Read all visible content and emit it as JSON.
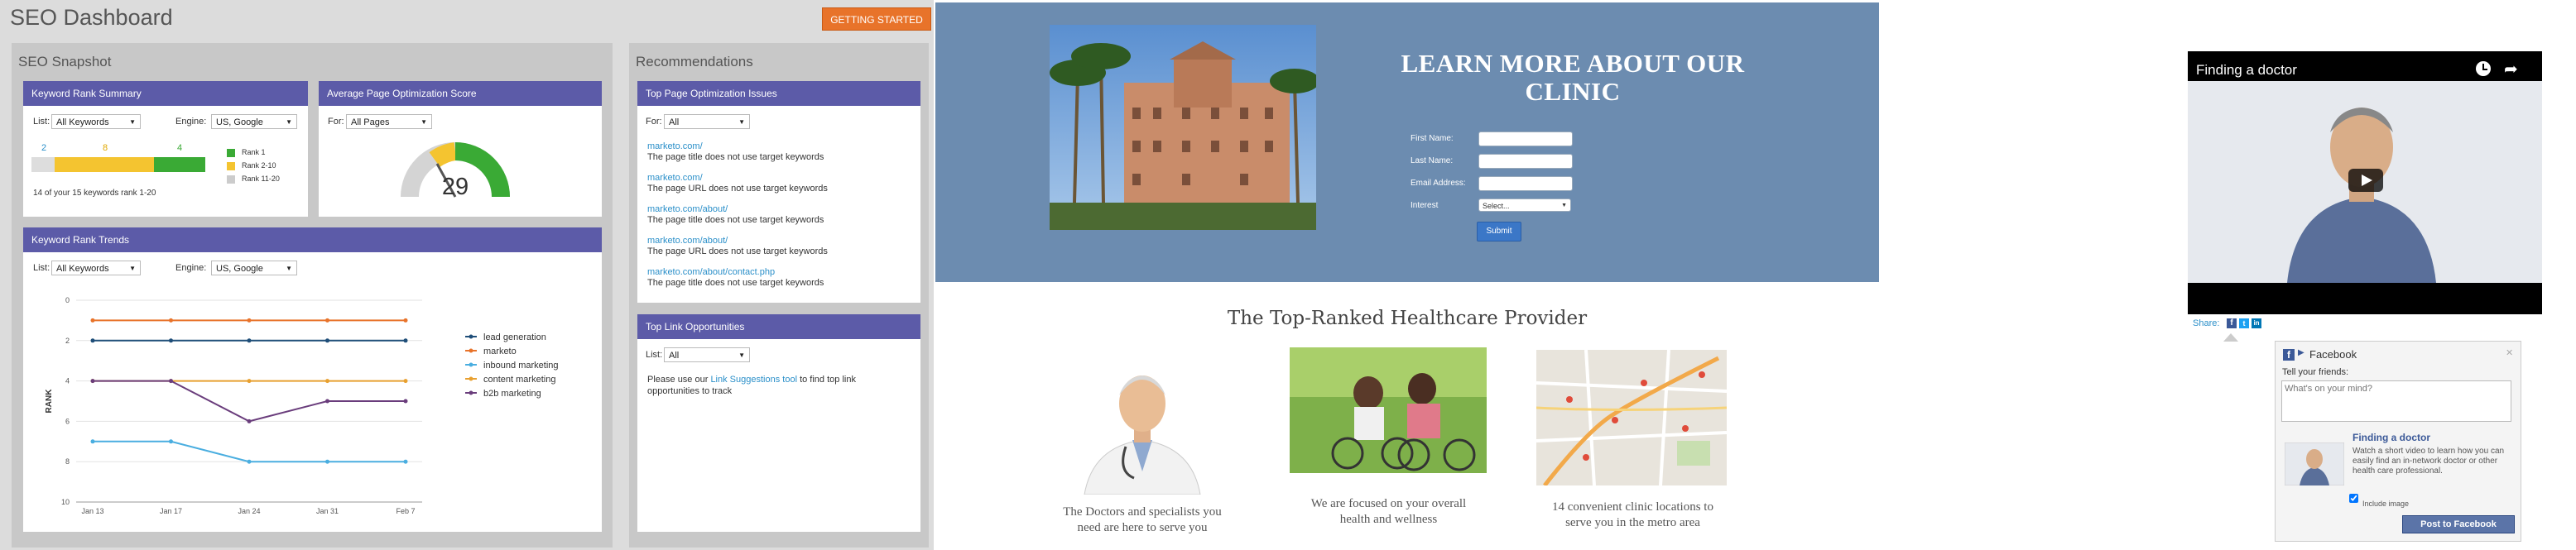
{
  "dashboard": {
    "title": "SEO Dashboard",
    "getting_started": "GETTING STARTED",
    "snapshot_title": "SEO Snapshot",
    "recommendations_title": "Recommendations",
    "krs": {
      "title": "Keyword Rank Summary",
      "list_label": "List:",
      "list_value": "All Keywords",
      "engine_label": "Engine:",
      "engine_value": "US, Google",
      "counts": [
        "2",
        "8",
        "4"
      ],
      "legend": [
        "Rank 1",
        "Rank 2-10",
        "Rank 11-20"
      ],
      "legend_colors": [
        "#3aaa35",
        "#f4c430",
        "#cccccc"
      ],
      "footnote": "14 of your 15 keywords rank 1-20"
    },
    "apos": {
      "title": "Average Page Optimization Score",
      "for_label": "For:",
      "for_value": "All Pages",
      "score": "29",
      "score_value": 29
    },
    "krt": {
      "title": "Keyword Rank Trends",
      "list_label": "List:",
      "list_value": "All Keywords",
      "engine_label": "Engine:",
      "engine_value": "US, Google"
    },
    "tpoi": {
      "title": "Top Page Optimization Issues",
      "for_label": "For:",
      "for_value": "All",
      "items": [
        {
          "url": "marketo.com/",
          "msg": "The page title does not use target keywords"
        },
        {
          "url": "marketo.com/",
          "msg": "The page URL does not use target keywords"
        },
        {
          "url": "marketo.com/about/",
          "msg": "The page title does not use target keywords"
        },
        {
          "url": "marketo.com/about/",
          "msg": "The page URL does not use target keywords"
        },
        {
          "url": "marketo.com/about/contact.php",
          "msg": "The page title does not use target keywords"
        }
      ]
    },
    "tlo": {
      "title": "Top Link Opportunities",
      "list_label": "List:",
      "list_value": "All",
      "text_pre": "Please use our ",
      "text_link": "Link Suggestions tool",
      "text_post": " to find top link opportunities to track"
    }
  },
  "chart_data": {
    "type": "line",
    "ylabel": "RANK",
    "xlabel": "",
    "x": [
      "Jan 13",
      "Jan 17",
      "Jan 24",
      "Jan 31",
      "Feb 7"
    ],
    "ylim": [
      10,
      0
    ],
    "yticks": [
      "0",
      "2",
      "4",
      "6",
      "8",
      "10"
    ],
    "grid": true,
    "legend": "right",
    "series": [
      {
        "name": "lead generation",
        "color": "#1f4e79",
        "values": [
          2,
          2,
          2,
          2,
          2
        ]
      },
      {
        "name": "marketo",
        "color": "#e8732a",
        "values": [
          1,
          1,
          1,
          1,
          1
        ]
      },
      {
        "name": "inbound marketing",
        "color": "#4aaee0",
        "values": [
          7,
          7,
          8,
          8,
          8
        ]
      },
      {
        "name": "content marketing",
        "color": "#e8a030",
        "values": [
          4,
          4,
          4,
          4,
          4
        ]
      },
      {
        "name": "b2b marketing",
        "color": "#6a3d7c",
        "values": [
          4,
          4,
          6,
          5,
          5
        ]
      }
    ]
  },
  "clinic": {
    "hero_title": "LEARN MORE ABOUT OUR CLINIC",
    "form": {
      "first_name": "First Name:",
      "last_name": "Last Name:",
      "email": "Email Address:",
      "interest": "Interest",
      "interest_value": "Select...",
      "submit": "Submit"
    },
    "heading": "The Top-Ranked Healthcare Provider",
    "captions": [
      "The Doctors and  specialists you need are here to serve you",
      "We are focused on your overall health and wellness",
      "14 convenient clinic locations to serve you in the metro area"
    ]
  },
  "video": {
    "title": "Finding a doctor",
    "share_label": "Share:"
  },
  "facebook": {
    "brand": "Facebook",
    "tell": "Tell your friends:",
    "placeholder": "What's on your mind?",
    "link_title": "Finding a doctor",
    "link_desc": "Watch a short video to learn how you can easily find an in-network doctor or other health care professional.",
    "include_image": "Include image",
    "post_button": "Post to Facebook",
    "colors": {
      "brand": "#3b5998"
    }
  }
}
